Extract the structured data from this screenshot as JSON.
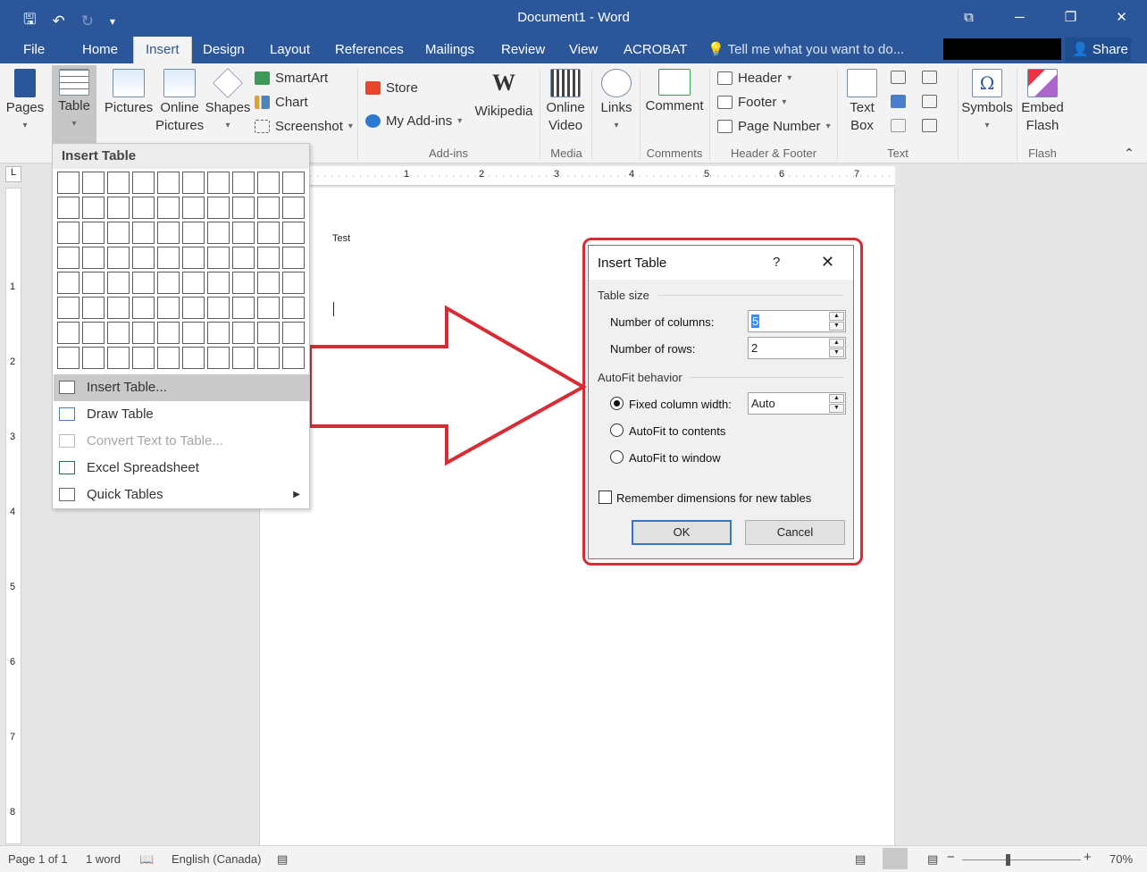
{
  "app": {
    "title": "Document1 - Word",
    "window_controls": [
      "⧉",
      "─",
      "❐",
      "✕"
    ]
  },
  "qat": {
    "save_icon": "save-icon",
    "undo_icon": "undo-icon",
    "redo_icon": "redo-icon",
    "customize_icon": "customize-icon"
  },
  "tabs": [
    "File",
    "Home",
    "Insert",
    "Design",
    "Layout",
    "References",
    "Mailings",
    "Review",
    "View",
    "ACROBAT"
  ],
  "active_tab": "Insert",
  "tell_me": "Tell me what you want to do...",
  "share": "Share",
  "ribbon": {
    "pages": "Pages",
    "table": "Table",
    "pictures": "Pictures",
    "online_pictures_1": "Online",
    "online_pictures_2": "Pictures",
    "shapes": "Shapes",
    "smartart": "SmartArt",
    "chart": "Chart",
    "screenshot": "Screenshot",
    "store": "Store",
    "my_addins": "My Add-ins",
    "wikipedia": "Wikipedia",
    "addins_group": "Add-ins",
    "online_video_1": "Online",
    "online_video_2": "Video",
    "media_group": "Media",
    "links": "Links",
    "comment": "Comment",
    "comments_group": "Comments",
    "header": "Header",
    "footer": "Footer",
    "page_number": "Page Number",
    "header_footer_group": "Header & Footer",
    "text_box_1": "Text",
    "text_box_2": "Box",
    "text_group": "Text",
    "symbols": "Symbols",
    "embed_flash_1": "Embed",
    "embed_flash_2": "Flash",
    "flash_group": "Flash"
  },
  "ruler": {
    "corner": "L",
    "top_numbers": [
      "1",
      "2",
      "3",
      "4",
      "5",
      "6",
      "7"
    ],
    "left_numbers": [
      "1",
      "2",
      "3",
      "4",
      "5",
      "6",
      "7",
      "8"
    ]
  },
  "document": {
    "text": "Test"
  },
  "insert_table_menu": {
    "title": "Insert Table",
    "grid_cols": 10,
    "grid_rows": 8,
    "items": [
      {
        "label": "Insert Table...",
        "icon": "table-icon",
        "highlight": true
      },
      {
        "label": "Draw Table",
        "icon": "draw-table-icon"
      },
      {
        "label": "Convert Text to Table...",
        "icon": "convert-text-icon",
        "disabled": true
      },
      {
        "label": "Excel Spreadsheet",
        "icon": "excel-icon"
      },
      {
        "label": "Quick Tables",
        "icon": "quick-tables-icon",
        "submenu": true
      }
    ]
  },
  "dialog": {
    "title": "Insert Table",
    "help": "?",
    "close": "✕",
    "table_size": "Table size",
    "columns_label": "Number of columns:",
    "columns_value": "5",
    "rows_label": "Number of rows:",
    "rows_value": "2",
    "autofit": "AutoFit behavior",
    "fixed_label": "Fixed column width:",
    "fixed_value": "Auto",
    "autofit_contents": "AutoFit to contents",
    "autofit_window": "AutoFit to window",
    "remember": "Remember dimensions for new tables",
    "ok": "OK",
    "cancel": "Cancel"
  },
  "status": {
    "page": "Page 1 of 1",
    "words": "1 word",
    "language": "English (Canada)",
    "zoom": "70%",
    "minus": "−",
    "plus": "+"
  },
  "colors": {
    "brand": "#2b579a",
    "highlight": "#d92b35"
  }
}
